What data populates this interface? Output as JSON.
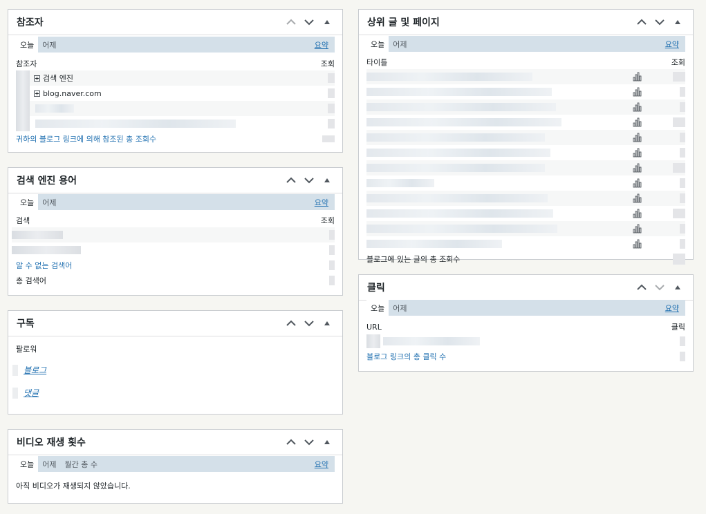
{
  "referrers": {
    "title": "참조자",
    "tabs": [
      "오늘",
      "어제"
    ],
    "summary": "요약",
    "col_left": "참조자",
    "col_right": "조회",
    "rows": [
      "검색 엔진",
      "blog.naver.com"
    ],
    "footer": "귀하의 블로그 링크에 의해 참조된 총 조회수"
  },
  "search_terms": {
    "title": "검색 엔진 용어",
    "tabs": [
      "오늘",
      "어제"
    ],
    "summary": "요약",
    "col_left": "검색",
    "col_right": "조회",
    "unknown": "알 수 없는 검색어",
    "total": "총 검색어"
  },
  "subscriptions": {
    "title": "구독",
    "followers": "팔로워",
    "blog_link": "블로그",
    "comments_link": "댓글"
  },
  "video": {
    "title": "비디오 재생 횟수",
    "tabs": [
      "오늘",
      "어제",
      "월간 총 수"
    ],
    "summary": "요약",
    "empty": "아직 비디오가 재생되지 않았습니다."
  },
  "top_posts": {
    "title": "상위 글 및 페이지",
    "tabs": [
      "오늘",
      "어제"
    ],
    "summary": "요약",
    "col_left": "타이틀",
    "col_right": "조회",
    "footer": "블로그에 있는 글의 총 조회수"
  },
  "clicks": {
    "title": "클릭",
    "tabs": [
      "오늘",
      "어제"
    ],
    "summary": "요약",
    "col_left": "URL",
    "col_right": "클릭",
    "footer": "블로그 링크의 총 클릭 수"
  }
}
